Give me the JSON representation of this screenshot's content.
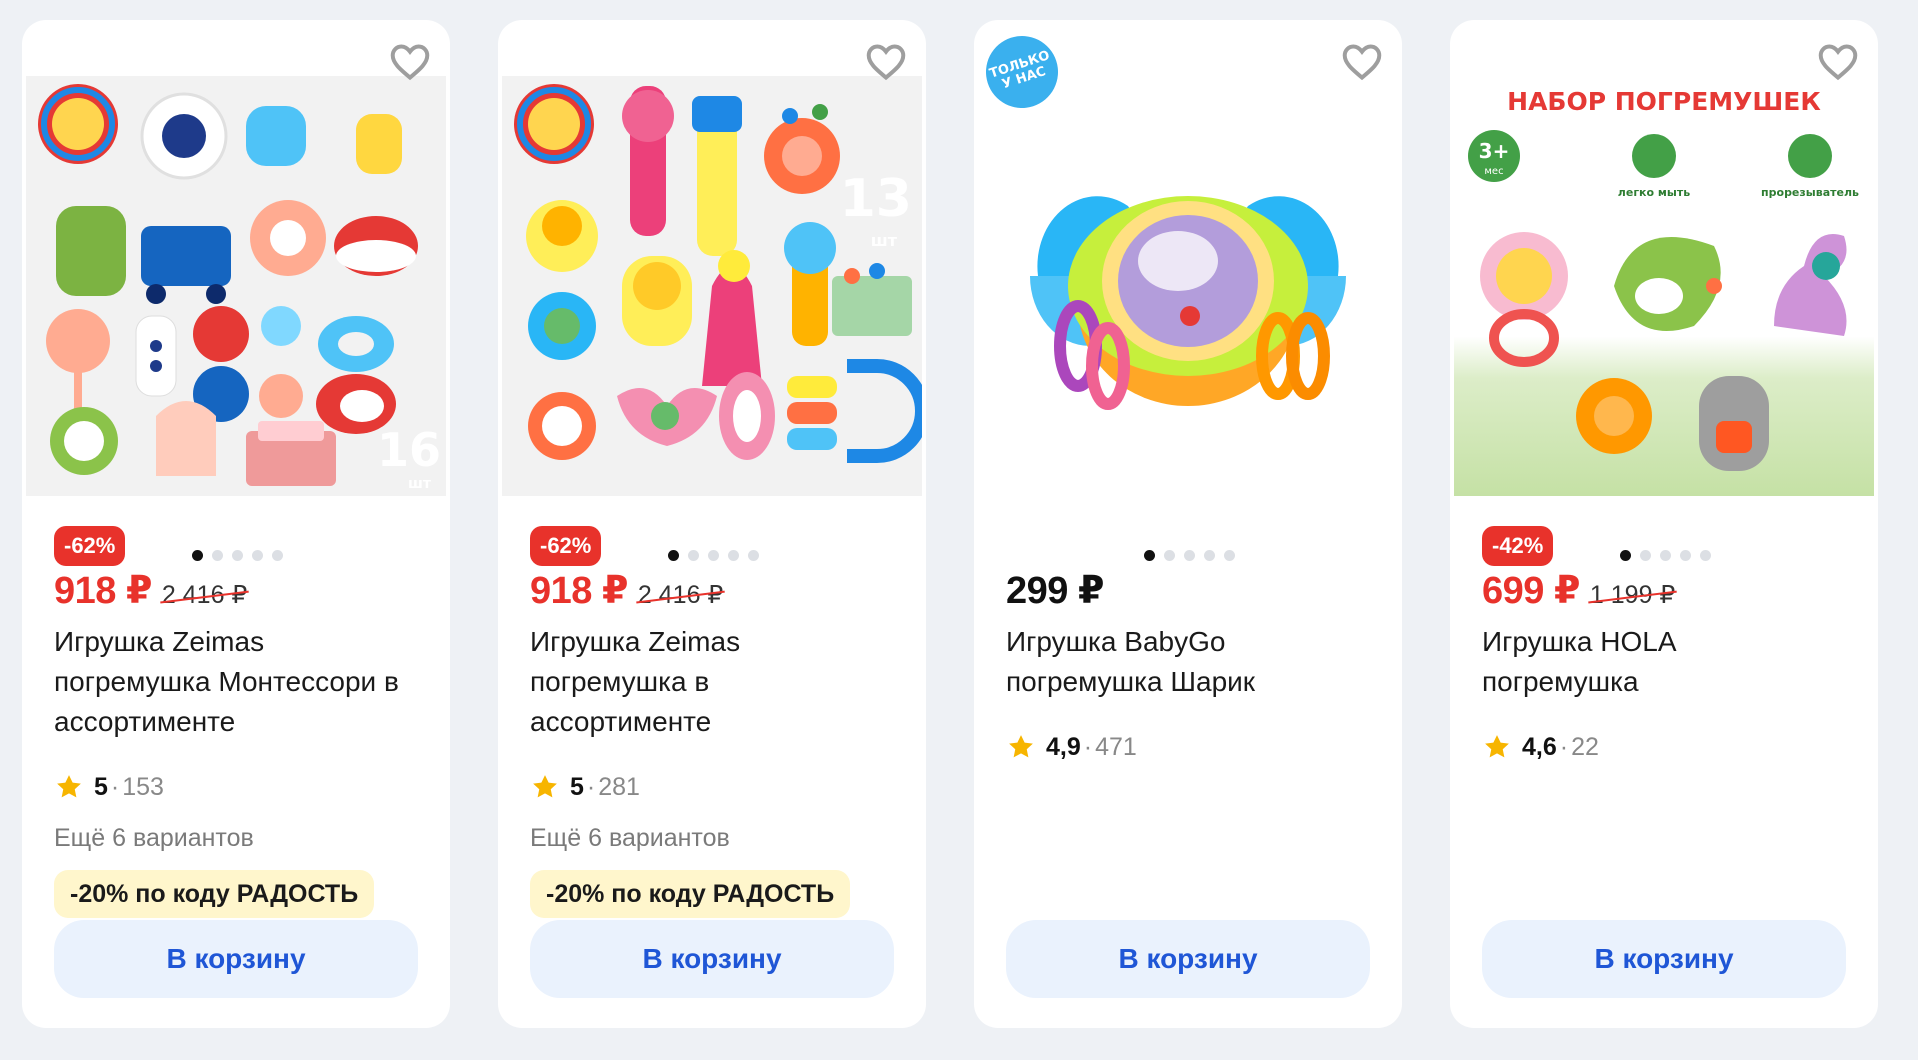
{
  "products": [
    {
      "discount": "-62%",
      "price": "918 ₽",
      "old_price": "2 416 ₽",
      "title": "Игрушка Zeimas погремушка Монтессори в ассортименте",
      "rating": "5",
      "reviews": "153",
      "variants": "Ещё 6 вариантов",
      "promo": "-20% по коду РАДОСТЬ",
      "cart_label": "В корзину",
      "image_label": "16",
      "image_sublabel": "шт"
    },
    {
      "discount": "-62%",
      "price": "918 ₽",
      "old_price": "2 416 ₽",
      "title": "Игрушка Zeimas погремушка в ассортименте",
      "rating": "5",
      "reviews": "281",
      "variants": "Ещё 6 вариантов",
      "promo": "-20% по коду РАДОСТЬ",
      "cart_label": "В корзину",
      "image_label": "13",
      "image_sublabel": "шт"
    },
    {
      "badge": "Только у нас",
      "price": "299 ₽",
      "title": "Игрушка BabyGo погремушка Шарик",
      "rating": "4,9",
      "reviews": "471",
      "cart_label": "В корзину"
    },
    {
      "discount": "-42%",
      "price": "699 ₽",
      "old_price": "1 199 ₽",
      "title": "Игрушка HOLA погремушка",
      "rating": "4,6",
      "reviews": "22",
      "cart_label": "В корзину",
      "image_title": "НАБОР ПОГРЕМУШЕК",
      "image_age": "3+",
      "image_age_unit": "мес",
      "image_feature_1": "легко мыть",
      "image_feature_2": "прорезыватель"
    }
  ],
  "icons": {
    "favorite": "heart-outline-icon",
    "rating": "star-icon"
  },
  "colors": {
    "discount": "#e8322b",
    "accent_button_text": "#1f56d6",
    "button_bg": "#eaf2fd",
    "promo_bg": "#fff6cc",
    "star": "#f7b500",
    "only_badge": "#3ab0ee"
  }
}
